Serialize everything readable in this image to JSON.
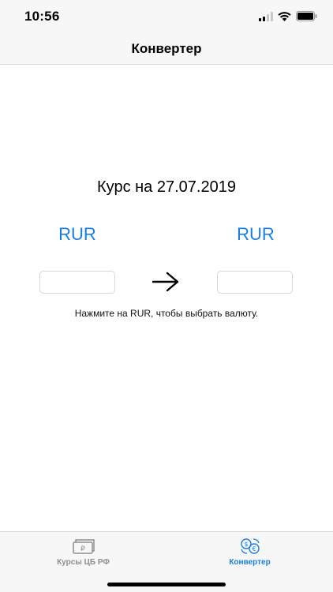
{
  "status_bar": {
    "time": "10:56"
  },
  "nav": {
    "title": "Конвертер"
  },
  "rate": {
    "title": "Курс на 27.07.2019"
  },
  "converter": {
    "from_currency": "RUR",
    "to_currency": "RUR",
    "from_value": "",
    "to_value": "",
    "hint": "Нажмите на RUR, чтобы выбрать валюту."
  },
  "tabs": [
    {
      "label": "Курсы ЦБ РФ",
      "icon": "banknote-icon",
      "active": false
    },
    {
      "label": "Конвертер",
      "icon": "currency-exchange-icon",
      "active": true
    }
  ],
  "colors": {
    "accent": "#1a7ee0",
    "inactive": "#8e8e93",
    "bar_bg": "#f7f7f7"
  }
}
